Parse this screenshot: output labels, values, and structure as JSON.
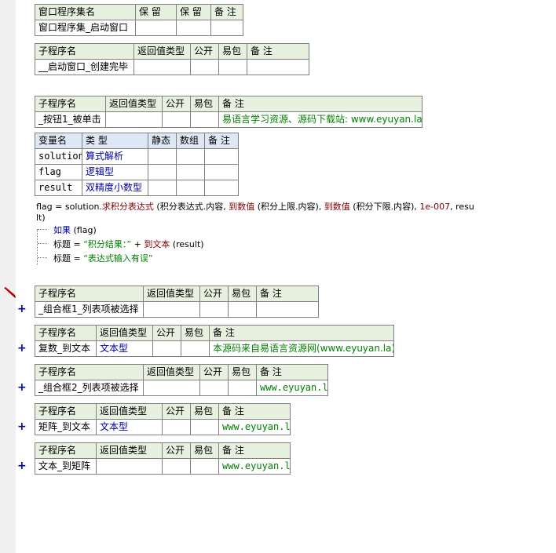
{
  "set": {
    "headers": [
      "窗口程序集名",
      "保 留",
      "保 留",
      "备 注"
    ],
    "name": "窗口程序集_启动窗口"
  },
  "sub_header": {
    "name": "子程序名",
    "ret": "返回值类型",
    "pub": "公开",
    "easy": "易包",
    "note": "备 注"
  },
  "subs": {
    "s1": {
      "name": "__启动窗口_创建完毕"
    },
    "s2": {
      "name": "_按钮1_被单击",
      "note": "易语言学习资源、源码下载站: www.eyuyan.la"
    },
    "s3": {
      "name": "_组合框1_列表项被选择"
    },
    "s4": {
      "name": "复数_到文本",
      "ret": "文本型",
      "note": "本源码来自易语言资源网(www.eyuyan.la)"
    },
    "s5": {
      "name": "_组合框2_列表项被选择",
      "note": "www.eyuyan.la"
    },
    "s6": {
      "name": "矩阵_到文本",
      "ret": "文本型",
      "note": "www.eyuyan.la"
    },
    "s7": {
      "name": "文本_到矩阵",
      "note": "www.eyuyan.la"
    }
  },
  "vars": {
    "headers": [
      "变量名",
      "类 型",
      "静态",
      "数组",
      "备 注"
    ],
    "rows": [
      {
        "name": "solution",
        "type": "算式解析"
      },
      {
        "name": "flag",
        "type": "逻辑型"
      },
      {
        "name": "result",
        "type": "双精度小数型"
      }
    ]
  },
  "code": {
    "l1_a": "flag = solution.",
    "l1_fn1": "求积分表达式",
    "l1_b": " (积分表达式.内容, ",
    "l1_fn2": "到数值",
    "l1_c": " (积分上限.内容), ",
    "l1_fn3": "到数值",
    "l1_d": " (积分下限.内容), ",
    "l1_num": "1e-007",
    "l1_e": ", resu",
    "l2": "lt)",
    "if_kw": "如果",
    "if_arg": " (flag)",
    "t1_a": "标题 = ",
    "t1_str": "“积分结果：”",
    "t1_b": " + ",
    "t1_fn": "到文本",
    "t1_c": " (result)",
    "t2_a": "标题 = ",
    "t2_str": "“表达式输入有误”"
  },
  "expand_symbol": "+",
  "icons": {
    "edit": "pencil-icon"
  },
  "colors": {
    "header_bg": "#e8f0e0",
    "var_header_bg": "#dde8f4",
    "keyword": "#0000a0",
    "function": "#800000",
    "comment": "#008000"
  }
}
